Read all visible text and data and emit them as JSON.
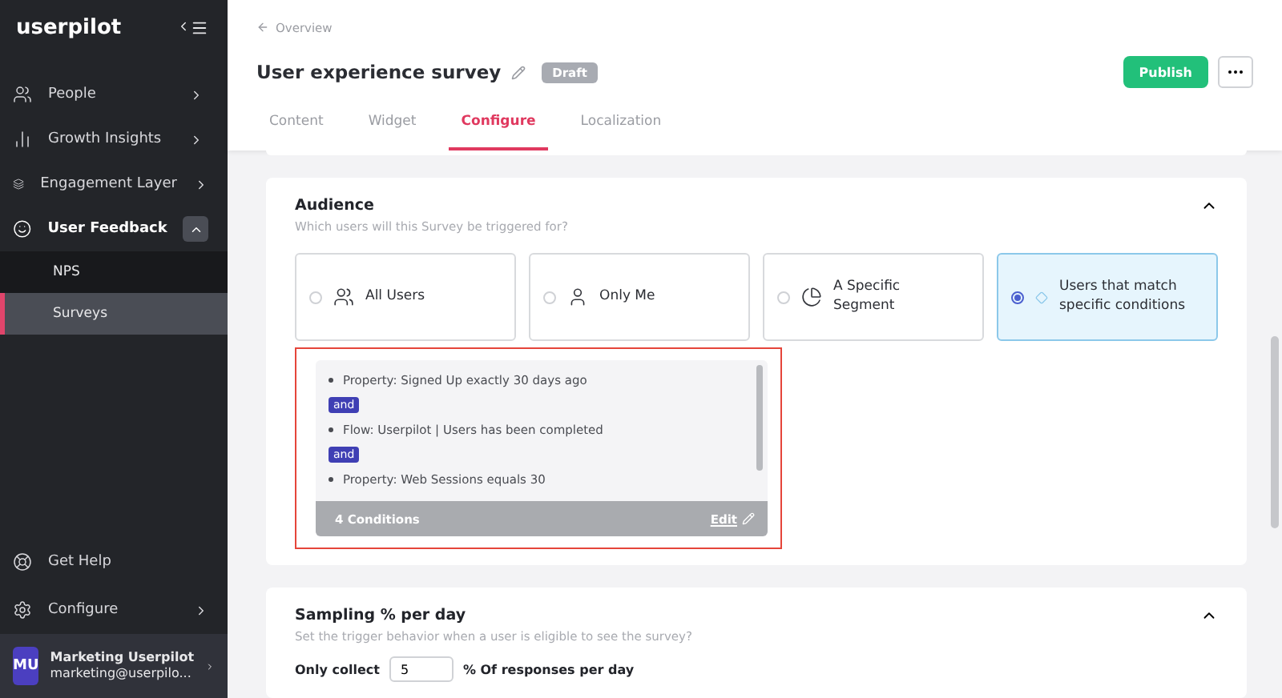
{
  "sidebar": {
    "logo": "userpilot",
    "items": [
      {
        "label": "People",
        "expanded": false,
        "selected": false
      },
      {
        "label": "Growth Insights",
        "expanded": false,
        "selected": false
      },
      {
        "label": "Engagement Layer",
        "expanded": false,
        "selected": false
      },
      {
        "label": "User Feedback",
        "expanded": true,
        "selected": true,
        "children": [
          {
            "label": "NPS",
            "selected": false
          },
          {
            "label": "Surveys",
            "selected": true
          }
        ]
      }
    ],
    "bottom_items": [
      {
        "label": "Get Help"
      },
      {
        "label": "Configure"
      }
    ],
    "account": {
      "initials": "MU",
      "name": "Marketing Userpilot",
      "email": "marketing@userpilo..."
    }
  },
  "header": {
    "breadcrumb": "Overview",
    "title": "User experience survey",
    "status": "Draft",
    "primary_button": "Publish",
    "tabs": [
      {
        "label": "Content",
        "selected": false
      },
      {
        "label": "Widget",
        "selected": false
      },
      {
        "label": "Configure",
        "selected": true
      },
      {
        "label": "Localization",
        "selected": false
      }
    ]
  },
  "audience": {
    "title": "Audience",
    "subtitle": "Which users will this Survey be triggered for?",
    "options": [
      {
        "label": "All Users",
        "selected": false
      },
      {
        "label": "Only Me",
        "selected": false
      },
      {
        "label": "A Specific Segment",
        "selected": false
      },
      {
        "label": "Users that match specific conditions",
        "selected": true
      }
    ],
    "conditions": [
      {
        "text": "Property: Signed Up exactly 30 days ago"
      },
      {
        "joiner": "and",
        "text": "Flow: Userpilot | Users has been completed"
      },
      {
        "joiner": "and",
        "text": "Property: Web Sessions equals 30"
      }
    ],
    "count": "4 Conditions",
    "edit": "Edit"
  },
  "sampling": {
    "title": "Sampling % per day",
    "subtitle": "Set the trigger behavior when a user is eligible to see the survey?",
    "prefix": "Only collect",
    "value": "5",
    "suffix": "% Of responses per day"
  }
}
